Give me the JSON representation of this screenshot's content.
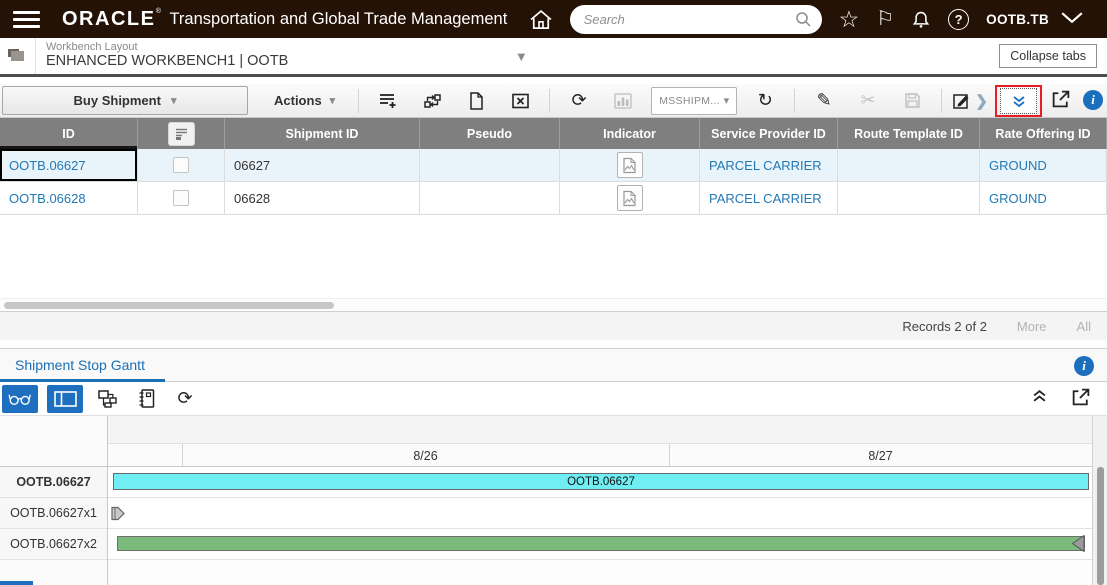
{
  "header": {
    "brand": "ORACLE",
    "title": "Transportation and Global Trade Management",
    "search_placeholder": "Search",
    "account": "OOTB.TB"
  },
  "workbench": {
    "label": "Workbench Layout",
    "value": "ENHANCED WORKBENCH1 | OOTB",
    "collapse_button": "Collapse tabs"
  },
  "toolbar": {
    "primary_label": "Buy Shipment",
    "actions_label": "Actions",
    "query_value": "MSSHIPM..."
  },
  "table": {
    "columns": [
      "ID",
      "",
      "Shipment ID",
      "Pseudo",
      "Indicator",
      "Service Provider ID",
      "Route Template ID",
      "Rate Offering ID"
    ],
    "rows": [
      {
        "id": "OOTB.06627",
        "shipment_id": "06627",
        "pseudo": "",
        "service_provider_id": "PARCEL CARRIER",
        "route_template_id": "",
        "rate_offering_id": "GROUND"
      },
      {
        "id": "OOTB.06628",
        "shipment_id": "06628",
        "pseudo": "",
        "service_provider_id": "PARCEL CARRIER",
        "route_template_id": "",
        "rate_offering_id": "GROUND"
      }
    ],
    "footer": {
      "records": "Records 2 of 2",
      "more": "More",
      "all": "All"
    }
  },
  "gantt": {
    "tab_label": "Shipment Stop Gantt",
    "dates": [
      "8/26",
      "8/27"
    ],
    "rows": [
      {
        "label": "OOTB.06627",
        "bar_label": "OOTB.06627",
        "bar_type": "span",
        "color": "#6feef3"
      },
      {
        "label": "OOTB.06627x1",
        "bar_type": "milestone",
        "color": "#c9c9c9"
      },
      {
        "label": "OOTB.06627x2",
        "bar_type": "bar",
        "color": "#7cba7c"
      }
    ]
  },
  "colors": {
    "header_bg": "#251206",
    "accent_blue": "#1e6fc0",
    "link_blue": "#2279b5",
    "table_header_bg": "#7f7f7f",
    "selected_row_bg": "#e9f3fa",
    "cyan_bar": "#6feef3",
    "green_bar": "#7cba7c",
    "highlight_red": "#e31e25"
  },
  "icons": {
    "star": "☆",
    "flag": "⚐",
    "refresh": "⟳",
    "reload": "↻",
    "pencil": "✎",
    "cut": "✂",
    "caret": "▾"
  }
}
